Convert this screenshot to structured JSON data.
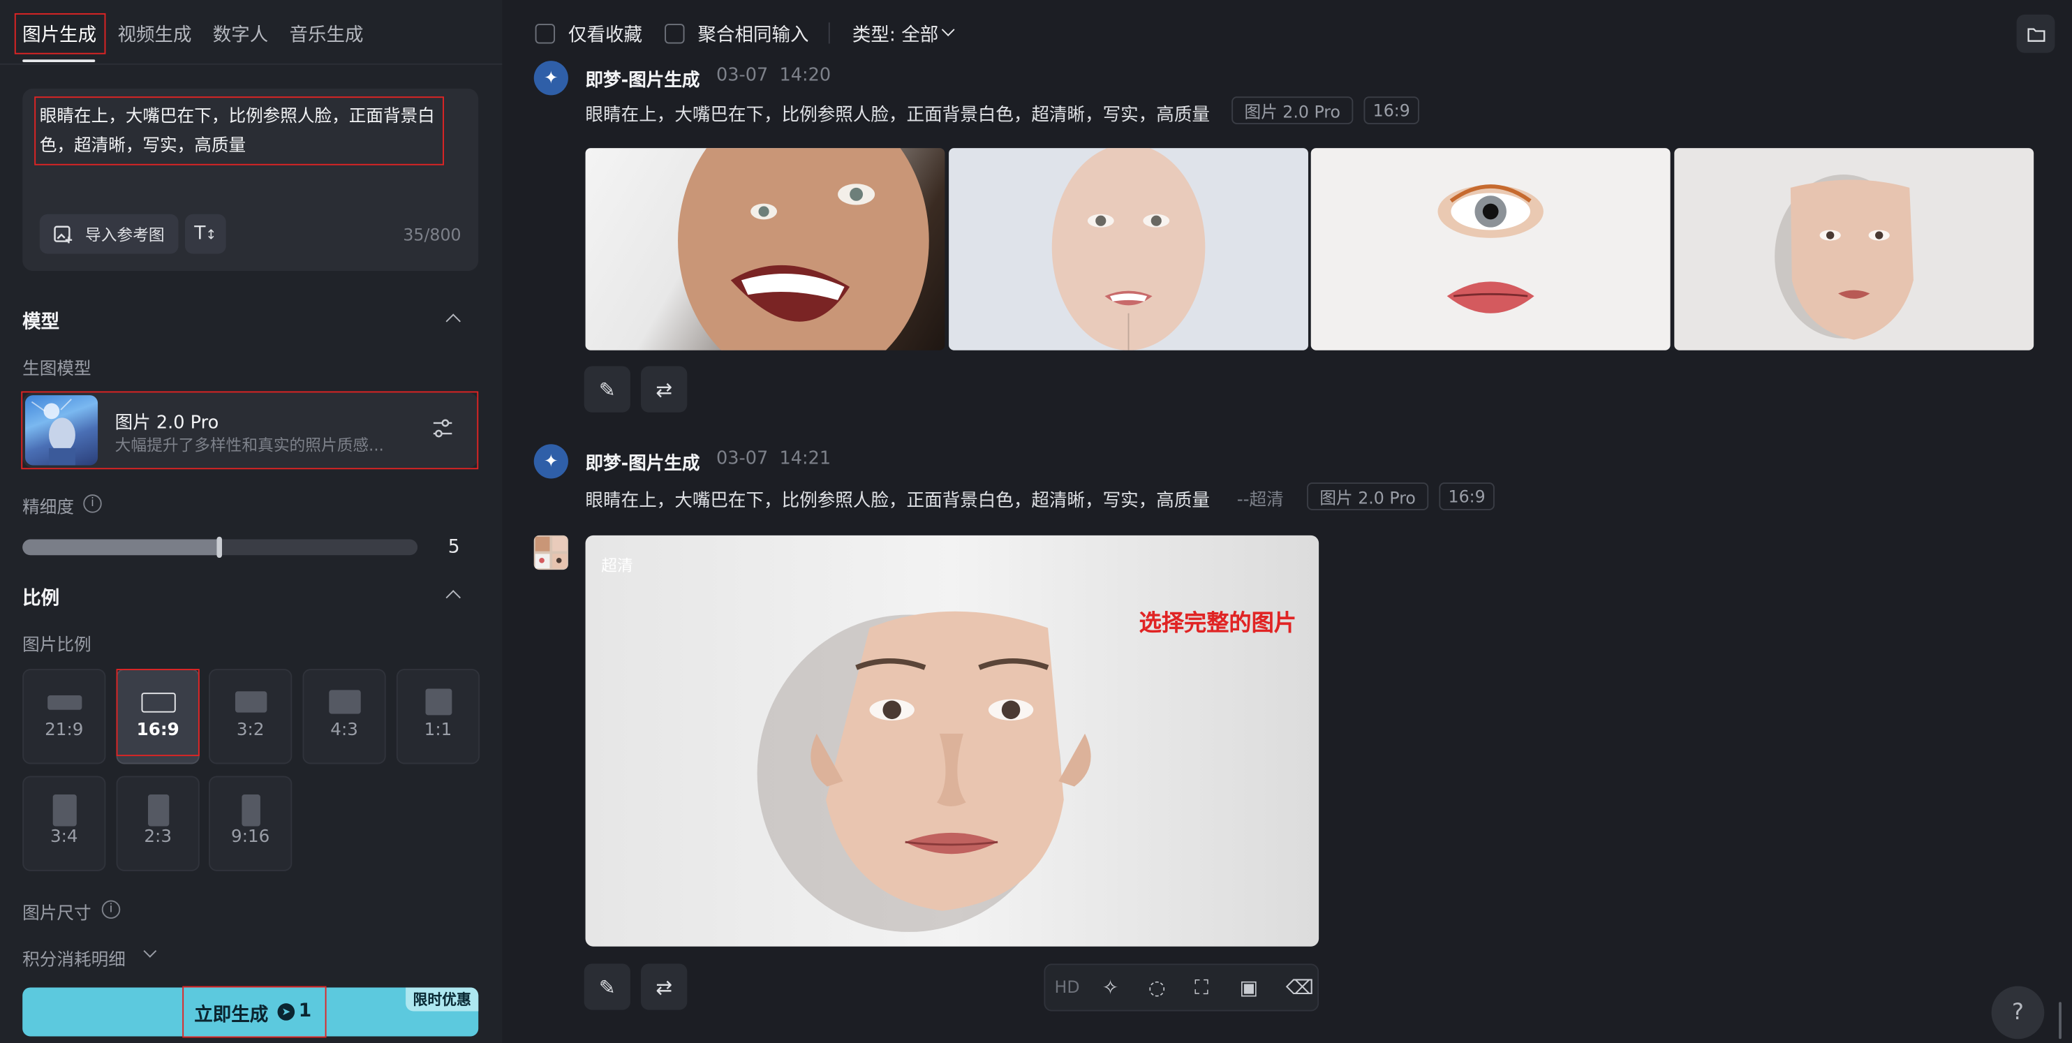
{
  "tabs": [
    "图片生成",
    "视频生成",
    "数字人",
    "音乐生成"
  ],
  "prompt": {
    "text": "眼睛在上，大嘴巴在下，比例参照人脸，正面背景白色，超清晰，写实，高质量",
    "import_label": "导入参考图",
    "char_count": "35/800"
  },
  "model_section": {
    "title": "模型",
    "subtitle": "生图模型",
    "model_name": "图片 2.0 Pro",
    "model_desc": "大幅提升了多样性和真实的照片质感...",
    "detail_label": "精细度",
    "detail_value": "5",
    "detail_level": 0.5
  },
  "ratio_section": {
    "title": "比例",
    "subtitle": "图片比例",
    "options": [
      "21:9",
      "16:9",
      "3:2",
      "4:3",
      "1:1",
      "3:4",
      "2:3",
      "9:16"
    ],
    "selected": "16:9",
    "size_label": "图片尺寸",
    "cost_label": "积分消耗明细"
  },
  "generate": {
    "label": "立即生成",
    "cost": "1",
    "promo": "限时优惠"
  },
  "toolbar": {
    "favorites_only": "仅看收藏",
    "aggregate_inputs": "聚合相同输入",
    "type_filter": "类型: 全部"
  },
  "generations": [
    {
      "title": "即梦-图片生成",
      "time": "03-07  14:20",
      "prompt": "眼睛在上，大嘴巴在下，比例参照人脸，正面背景白色，超清晰，写实，高质量",
      "model_tag": "图片 2.0 Pro",
      "ratio_tag": "16:9"
    },
    {
      "title": "即梦-图片生成",
      "time": "03-07  14:21",
      "prompt": "眼睛在上，大嘴巴在下，比例参照人脸，正面背景白色，超清晰，写实，高质量",
      "suffix": "--超清",
      "model_tag": "图片 2.0 Pro",
      "ratio_tag": "16:9",
      "image_badge": "超清",
      "annotation": "选择完整的图片"
    }
  ],
  "image_tools": {
    "hd_label": "HD"
  },
  "help_label": "?"
}
